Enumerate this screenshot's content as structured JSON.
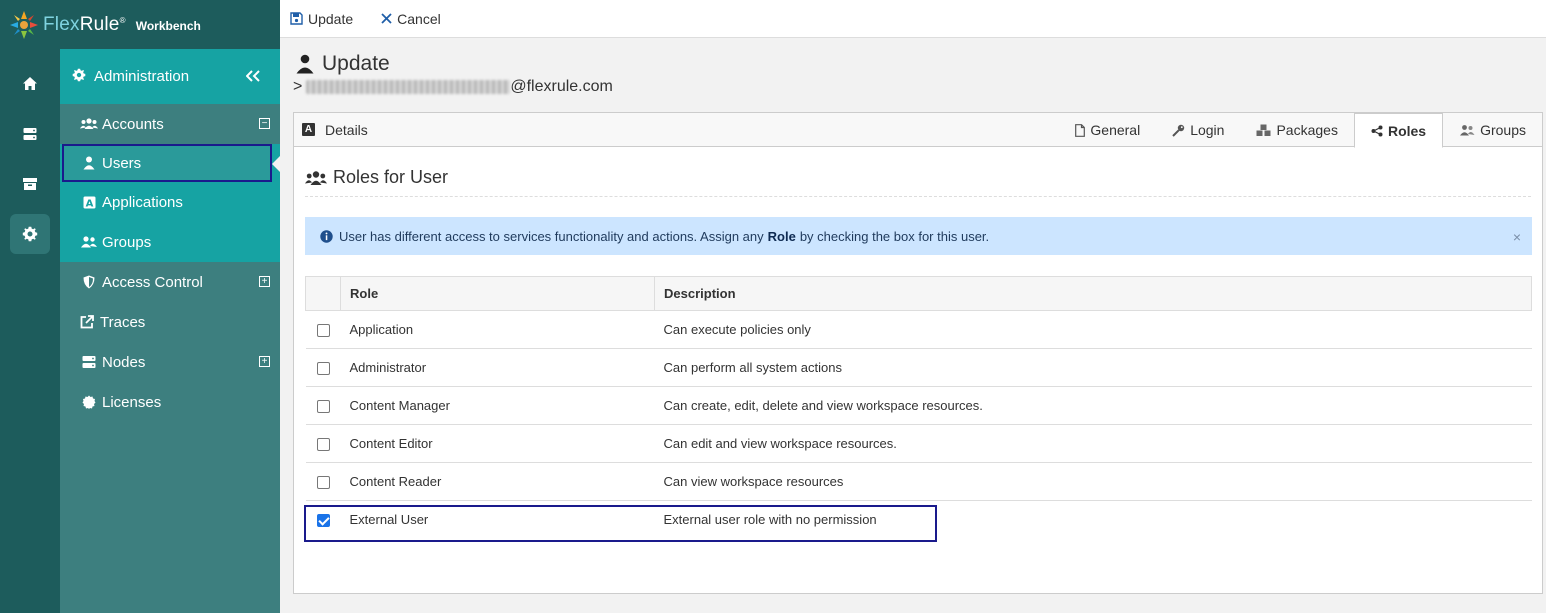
{
  "app": {
    "brand_flex": "Flex",
    "brand_rule": "Rule",
    "brand_reg": "®",
    "brand_sub": "Workbench"
  },
  "rail": {
    "items": [
      {
        "icon": "home-icon"
      },
      {
        "icon": "server-icon"
      },
      {
        "icon": "archive-icon"
      },
      {
        "icon": "gear-icon",
        "active": true
      }
    ]
  },
  "nav": {
    "header": "Administration",
    "items": [
      {
        "label": "Accounts",
        "icon": "users-icon",
        "expander": "⊟"
      },
      {
        "label": "Users",
        "icon": "user-icon",
        "selected": true
      },
      {
        "label": "Applications",
        "icon": "app-icon"
      },
      {
        "label": "Groups",
        "icon": "group-icon"
      },
      {
        "label": "Access Control",
        "icon": "shield-icon",
        "expander": "+"
      },
      {
        "label": "Traces",
        "icon": "external-link-icon"
      },
      {
        "label": "Nodes",
        "icon": "server-icon",
        "expander": "+"
      },
      {
        "label": "Licenses",
        "icon": "certificate-icon"
      }
    ]
  },
  "toolbar": {
    "update_label": "Update",
    "cancel_label": "Cancel"
  },
  "page": {
    "title": "Update",
    "crumb_prefix": ">",
    "email_domain": "@flexrule.com"
  },
  "card": {
    "details_badge": "A",
    "details_label": "Details",
    "tabs": [
      {
        "label": "General",
        "icon": "file-icon"
      },
      {
        "label": "Login",
        "icon": "key-icon"
      },
      {
        "label": "Packages",
        "icon": "cubes-icon"
      },
      {
        "label": "Roles",
        "icon": "share-icon",
        "active": true
      },
      {
        "label": "Groups",
        "icon": "group-icon"
      }
    ],
    "section_title": "Roles for User",
    "alert": {
      "text_before": "User has different access to services functionality and actions. Assign any",
      "text_bold": "Role",
      "text_after": "by checking the box for this user.",
      "close": "×"
    },
    "table": {
      "headers": [
        "",
        "Role",
        "Description"
      ],
      "rows": [
        {
          "checked": false,
          "role": "Application",
          "description": "Can execute policies only"
        },
        {
          "checked": false,
          "role": "Administrator",
          "description": "Can perform all system actions"
        },
        {
          "checked": false,
          "role": "Content Manager",
          "description": "Can create, edit, delete and view workspace resources."
        },
        {
          "checked": false,
          "role": "Content Editor",
          "description": "Can edit and view workspace resources."
        },
        {
          "checked": false,
          "role": "Content Reader",
          "description": "Can view workspace resources"
        },
        {
          "checked": true,
          "role": "External User",
          "description": "External user role with no permission"
        }
      ]
    }
  },
  "colors": {
    "rail_bg": "#1d5c5c",
    "nav_bg": "#3d7f7f",
    "nav_active": "#16a3a3",
    "alert_bg": "#cce5ff",
    "highlight": "#1a1a8c",
    "checkbox_on": "#1a73e8"
  }
}
